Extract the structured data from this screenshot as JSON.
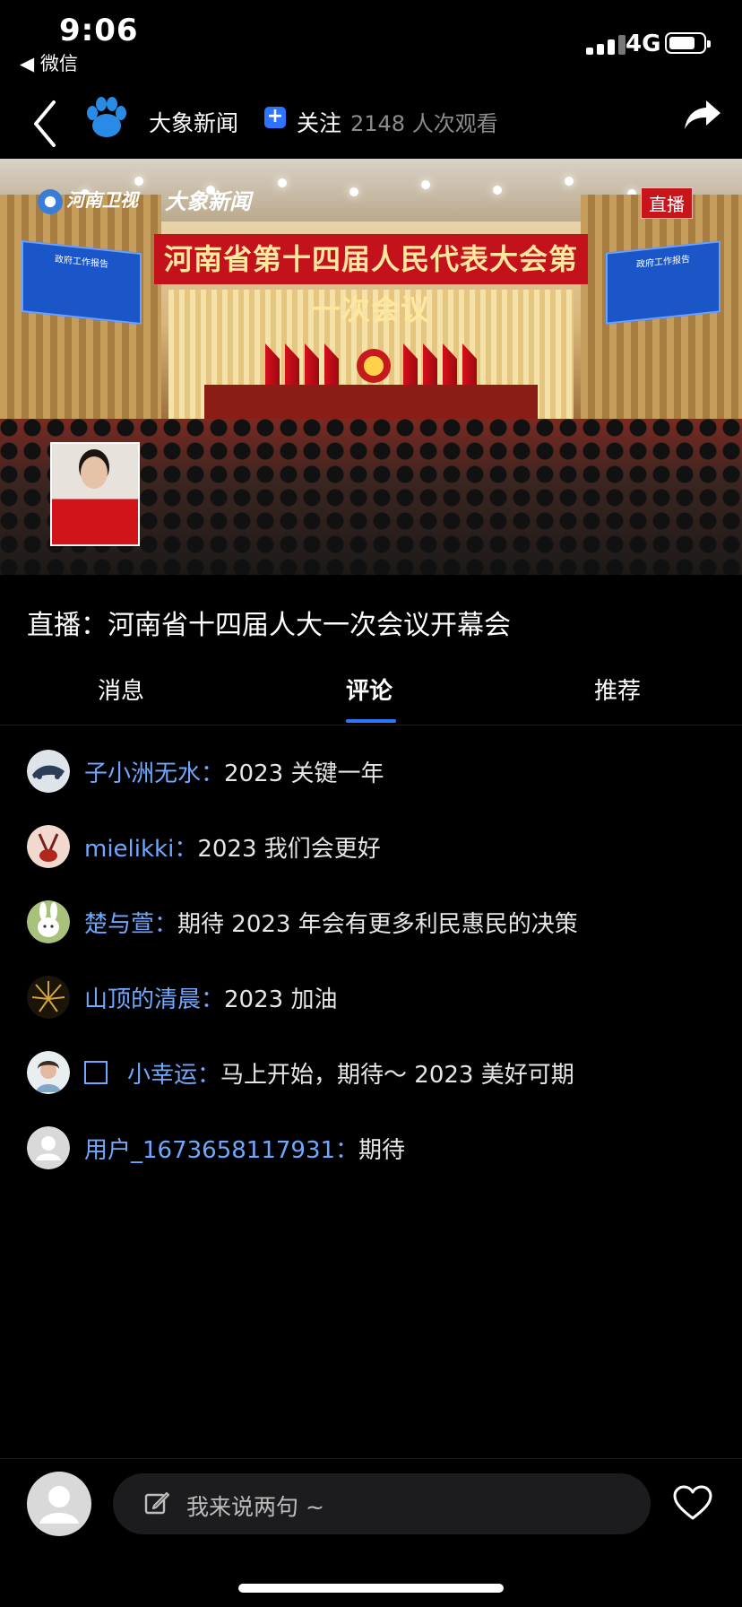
{
  "status_bar": {
    "time": "9:06",
    "back_app": "◀ 微信",
    "network": "4G",
    "battery_percent": 80
  },
  "header": {
    "channel_name": "大象新闻",
    "follow_label": "关注",
    "view_count": "2148 人次观看"
  },
  "video": {
    "logo_henan": "河南卫视",
    "logo_daxiang": "大象新闻",
    "live_badge": "直播",
    "banner_text": "河南省第十四届人民代表大会第一次会议",
    "screen_text": "政府工作报告"
  },
  "live_title": "直播：河南省十四届人大一次会议开幕会",
  "tabs": [
    {
      "label": "消息",
      "active": false
    },
    {
      "label": "评论",
      "active": true
    },
    {
      "label": "推荐",
      "active": false
    }
  ],
  "comments": [
    {
      "user": "子小洲无水：",
      "text": "2023 关键一年"
    },
    {
      "user": "mielikki：",
      "text": "2023 我们会更好"
    },
    {
      "user": "楚与萱：",
      "text": "期待 2023 年会有更多利民惠民的决策"
    },
    {
      "user": "山顶的清晨：",
      "text": "2023 加油"
    },
    {
      "user": "小幸运：",
      "text": "马上开始，期待～ 2023 美好可期",
      "has_emoji_box": true
    },
    {
      "user": "用户_1673658117931：",
      "text": "期待"
    }
  ],
  "bottom_bar": {
    "input_placeholder": "我来说两句 ~"
  },
  "colors": {
    "accent": "#2f74ff",
    "username": "#6fa8ff",
    "live_red": "#c8141b"
  }
}
